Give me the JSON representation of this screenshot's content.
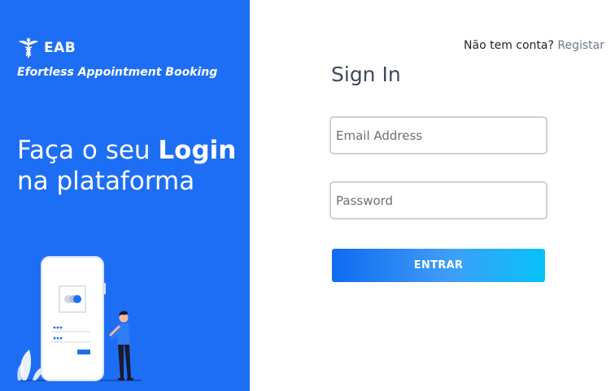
{
  "brand": {
    "name": "EAB",
    "tagline": "Efortless Appointment Booking",
    "logo_icon": "caduceus-icon"
  },
  "hero": {
    "line1_prefix": "Faça o seu ",
    "line1_bold": "Login",
    "line2": "na plataforma"
  },
  "illustration": {
    "icon": "phone-login-illustration",
    "colors": {
      "panel": "#1e6ef5",
      "phone": "#ffffff",
      "accent": "#1e6ef5"
    }
  },
  "signup": {
    "prompt": "Não tem conta?",
    "link_label": "Registar"
  },
  "form": {
    "title": "Sign In",
    "email_placeholder": "Email Address",
    "password_placeholder": "Password",
    "submit_label": "ENTRAR"
  },
  "colors": {
    "brand_blue": "#1e6ef5",
    "button_gradient_start": "#0f6bf0",
    "button_gradient_end": "#06c2fb",
    "title_text": "#3d4a5c",
    "link_text": "#6c7a8c"
  }
}
